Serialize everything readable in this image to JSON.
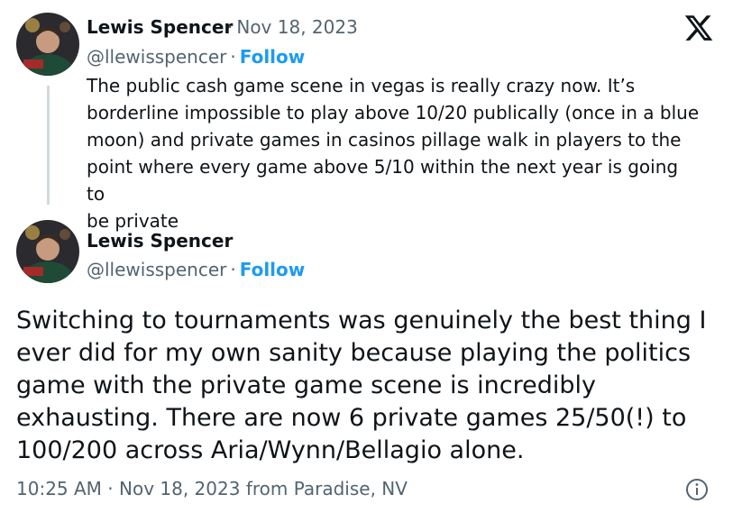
{
  "parent_tweet": {
    "author_name": "Lewis Spencer",
    "date": "Nov 18, 2023",
    "handle": "@llewisspencer",
    "follow_label": "Follow",
    "text_lines": [
      "The public cash game scene in vegas is really crazy now. It’s",
      "borderline impossible to play above 10/20 publically (once in a blue",
      "moon) and private games in casinos pillage walk in players to the",
      "point where every game above 5/10 within the next year is going to",
      "be private"
    ]
  },
  "main_tweet": {
    "author_name": "Lewis Spencer",
    "handle": "@llewisspencer",
    "follow_label": "Follow",
    "text_lines": [
      "Switching to tournaments was genuinely the best thing I",
      "ever did for my own sanity because playing the politics",
      "game with the private game scene is incredibly",
      "exhausting. There are now 6 private games 25/50(!) to",
      "100/200 across Aria/Wynn/Bellagio alone."
    ],
    "timestamp": "10:25 AM · Nov 18, 2023 from Paradise, NV"
  },
  "icons": {
    "logo": "x-logo-icon",
    "info": "info-icon"
  },
  "colors": {
    "follow": "#1d9bf0",
    "secondary_text": "#536471",
    "thread_line": "#cfd9de"
  }
}
